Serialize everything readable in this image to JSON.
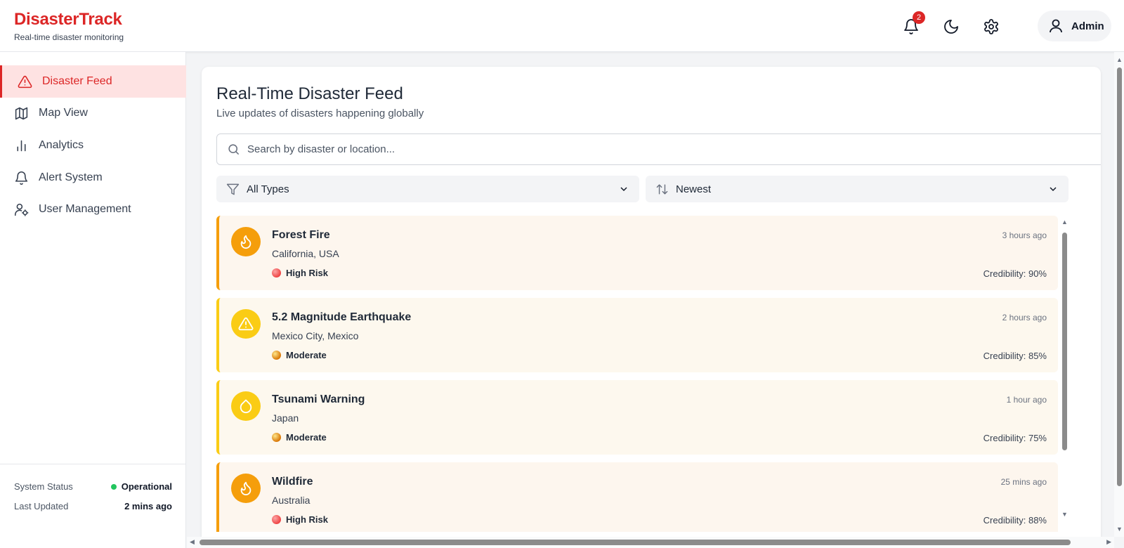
{
  "brand": {
    "title": "DisasterTrack",
    "subtitle": "Real-time disaster monitoring"
  },
  "header": {
    "notifications_count": "2",
    "user_label": "Admin",
    "icons": [
      "bell-icon",
      "moon-icon",
      "gear-icon",
      "user-icon"
    ]
  },
  "sidebar": {
    "items": [
      {
        "label": "Disaster Feed",
        "icon": "alert-triangle-icon",
        "active": true
      },
      {
        "label": "Map View",
        "icon": "map-icon",
        "active": false
      },
      {
        "label": "Analytics",
        "icon": "bar-chart-icon",
        "active": false
      },
      {
        "label": "Alert System",
        "icon": "bell-icon",
        "active": false
      },
      {
        "label": "User Management",
        "icon": "user-cog-icon",
        "active": false
      }
    ],
    "footer": {
      "status_label": "System Status",
      "status_value": "Operational",
      "updated_label": "Last Updated",
      "updated_value": "2 mins ago"
    }
  },
  "main": {
    "title": "Real-Time Disaster Feed",
    "subtitle": "Live updates of disasters happening globally",
    "search_placeholder": "Search by disaster or location...",
    "filter_type": "All Types",
    "sort_order": "Newest"
  },
  "feed": [
    {
      "title": "Forest Fire",
      "location": "California, USA",
      "risk": "High Risk",
      "time": "3 hours ago",
      "credibility": "Credibility: 90%",
      "icon": "flame-icon"
    },
    {
      "title": "5.2 Magnitude Earthquake",
      "location": "Mexico City, Mexico",
      "risk": "Moderate",
      "time": "2 hours ago",
      "credibility": "Credibility: 85%",
      "icon": "alert-triangle-icon"
    },
    {
      "title": "Tsunami Warning",
      "location": "Japan",
      "risk": "Moderate",
      "time": "1 hour ago",
      "credibility": "Credibility: 75%",
      "icon": "droplet-icon"
    },
    {
      "title": "Wildfire",
      "location": "Australia",
      "risk": "High Risk",
      "time": "25 mins ago",
      "credibility": "Credibility: 88%",
      "icon": "flame-icon"
    }
  ],
  "colors": {
    "brand": "#dc2626",
    "high": "#f59e0b",
    "moderate": "#facc15",
    "status_ok": "#22c55e"
  }
}
